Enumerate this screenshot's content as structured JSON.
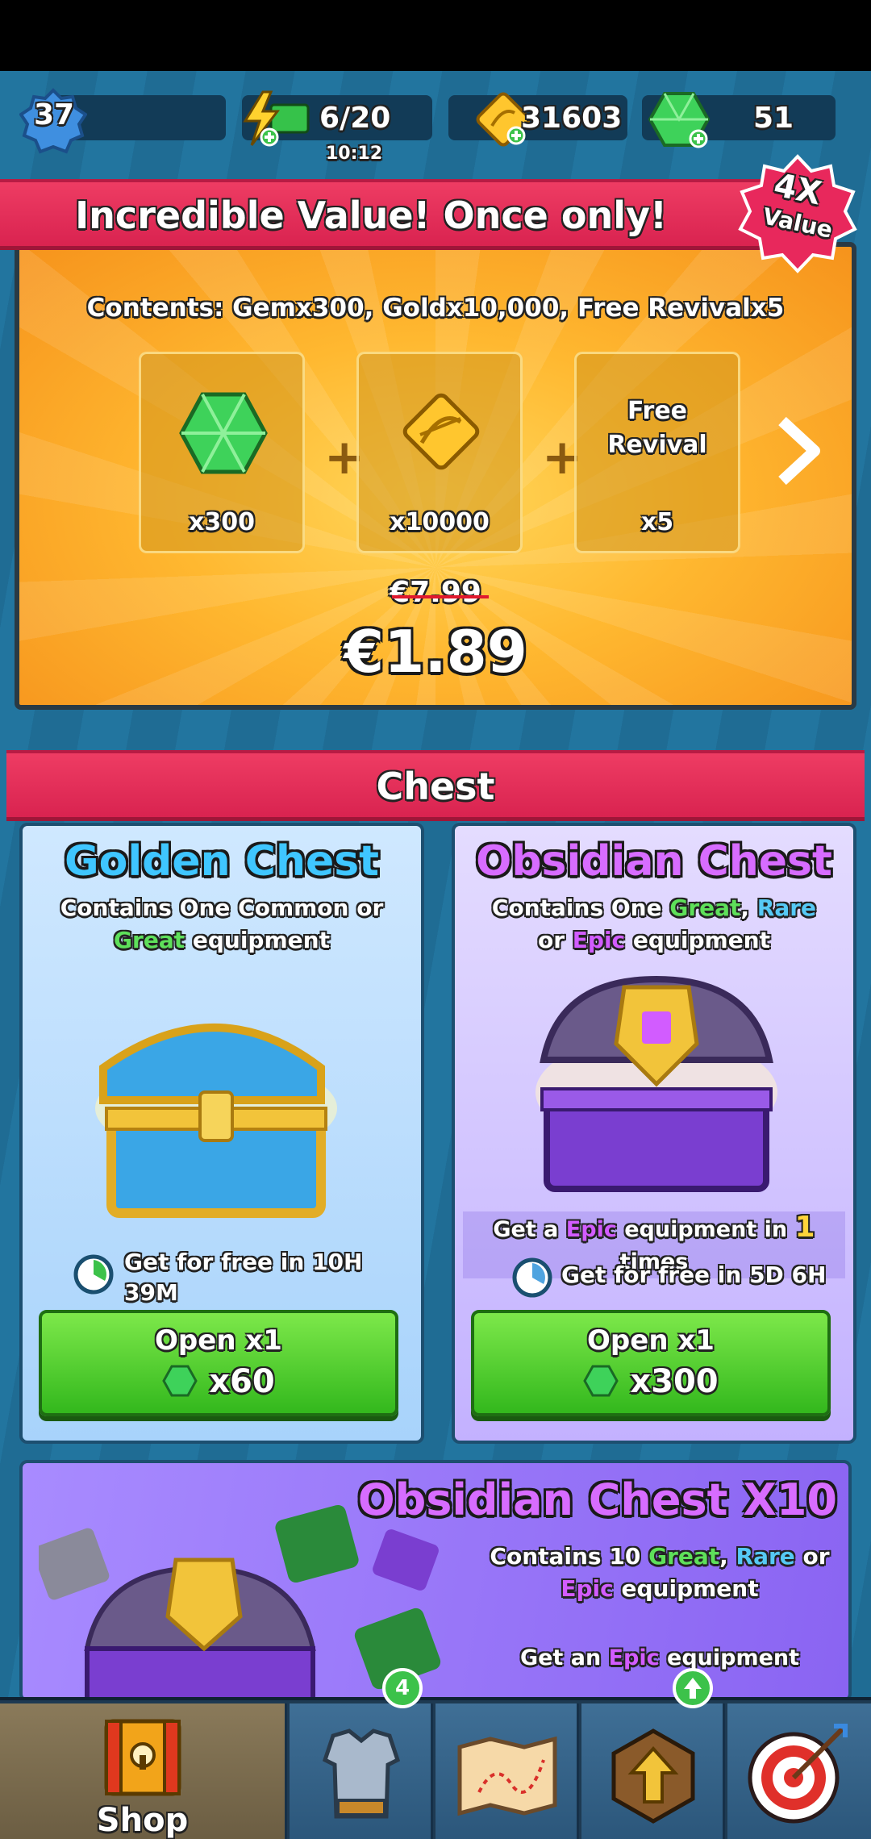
{
  "header": {
    "level": "37",
    "energy": "6/20",
    "energy_timer": "10:12",
    "gold": "31603",
    "gems": "51"
  },
  "offer": {
    "title": "Incredible Value! Once only!",
    "value_badge_top": "4X",
    "value_badge_bottom": "Value",
    "contents": "Contents: Gemx300, Goldx10,000, Free Revivalx5",
    "items": [
      {
        "qty": "x300",
        "icon": "gem-icon"
      },
      {
        "qty": "x10000",
        "icon": "gold-icon"
      },
      {
        "qty": "x5",
        "label": "Free Revival"
      }
    ],
    "old_price": "€7.99",
    "price": "€1.89"
  },
  "chest_section": {
    "title": "Chest",
    "golden": {
      "title": "Golden Chest",
      "desc_prefix": "Contains One",
      "rarity_1": "Common",
      "or": "or",
      "rarity_2": "Great",
      "desc_suffix": "equipment",
      "free_timer": "Get for free in 10H 39M",
      "button_label": "Open x1",
      "button_price": "x60"
    },
    "obsidian": {
      "title": "Obsidian Chest",
      "desc_prefix": "Contains One",
      "rarity_1": "Great",
      "comma": ",",
      "rarity_2": "Rare",
      "or": "or",
      "rarity_3": "Epic",
      "desc_suffix": "equipment",
      "pity_prefix": "Get a",
      "pity_rarity": "Epic",
      "pity_middle": "equipment in",
      "pity_count": "1",
      "pity_suffix": "times",
      "free_timer": "Get for free in 5D 6H",
      "button_label": "Open x1",
      "button_price": "x300"
    },
    "obsidian_x10": {
      "title": "Obsidian Chest X10",
      "desc_prefix": "Contains 10",
      "rarity_1": "Great",
      "comma": ",",
      "rarity_2": "Rare",
      "or": "or",
      "rarity_3": "Epic",
      "desc_suffix": "equipment",
      "pity_prefix": "Get an",
      "pity_rarity": "Epic",
      "pity_suffix": "equipment"
    }
  },
  "nav": {
    "shop_label": "Shop",
    "equipment_badge": "4"
  },
  "colors": {
    "banner_red": "#e12e58",
    "button_green": "#4fcf2c",
    "rarity_great": "#5ee05a",
    "rarity_rare": "#56c9f5",
    "rarity_epic": "#d25cff",
    "pity_gold": "#ffd43a"
  }
}
